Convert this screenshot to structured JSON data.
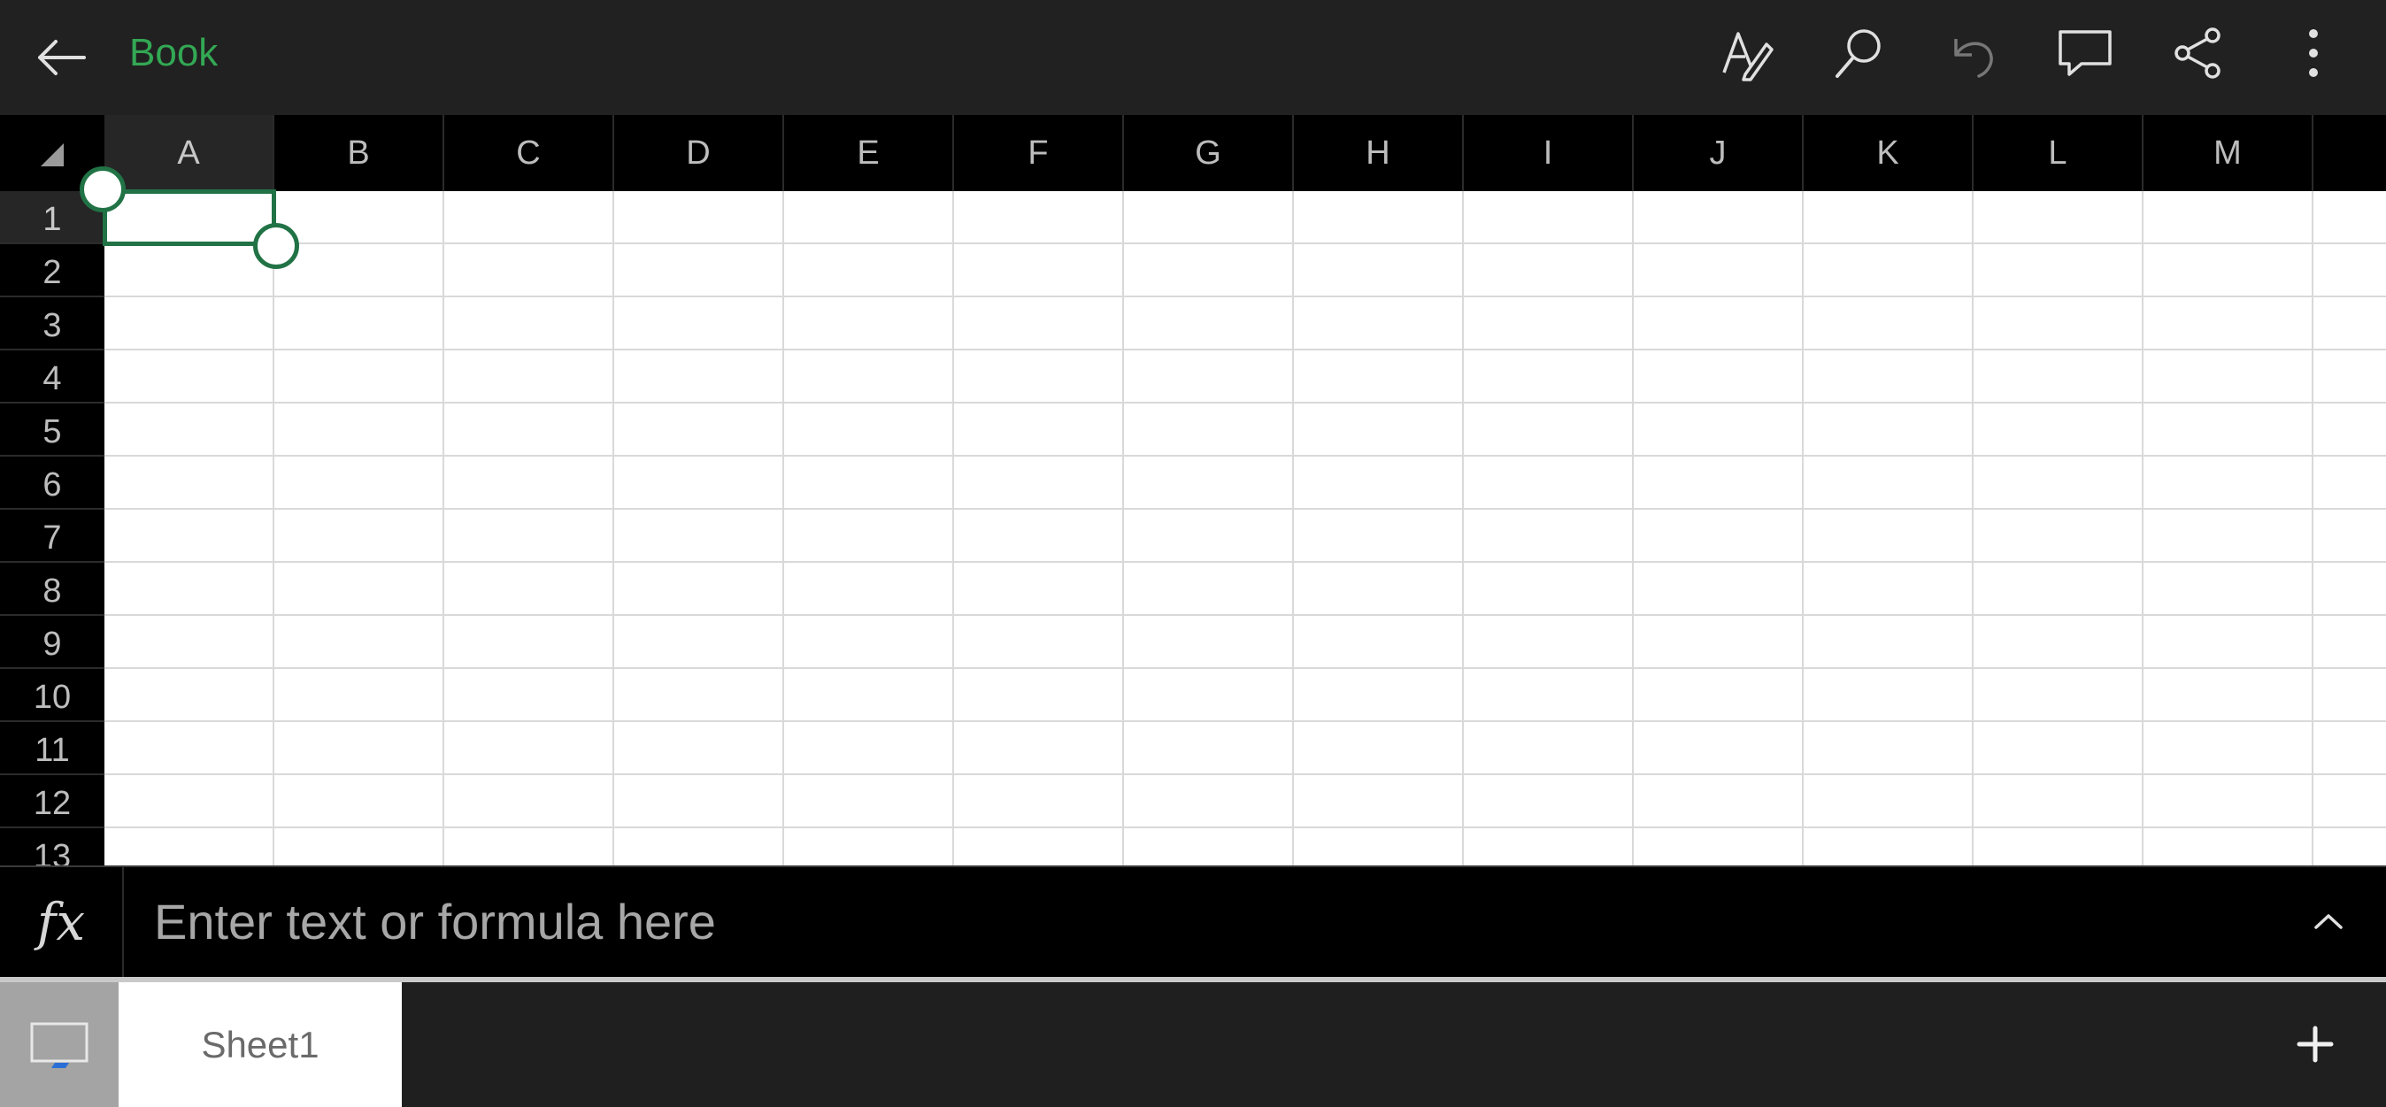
{
  "app": {
    "title": "Book",
    "accent_color": "#33a854",
    "selection_color": "#217346"
  },
  "toolbar": {
    "back_icon": "back-arrow-icon",
    "actions": [
      {
        "name": "draw-button",
        "icon": "pen-draw-icon"
      },
      {
        "name": "search-button",
        "icon": "search-icon"
      },
      {
        "name": "undo-button",
        "icon": "undo-icon",
        "disabled": true
      },
      {
        "name": "comment-button",
        "icon": "comment-icon"
      },
      {
        "name": "share-button",
        "icon": "share-icon"
      },
      {
        "name": "more-button",
        "icon": "more-vertical-icon"
      }
    ]
  },
  "grid": {
    "columns": [
      "A",
      "B",
      "C",
      "D",
      "E",
      "F",
      "G",
      "H",
      "I",
      "J",
      "K",
      "L",
      "M"
    ],
    "rows": [
      "1",
      "2",
      "3",
      "4",
      "5",
      "6",
      "7",
      "8",
      "9",
      "10",
      "11",
      "12",
      "13"
    ],
    "selected_cell": "A1"
  },
  "formula_bar": {
    "fx_label": "fx",
    "placeholder": "Enter text or formula here",
    "value": "",
    "expand_icon": "chevron-up-icon"
  },
  "sheets": {
    "view_icon": "sheets-view-icon",
    "tabs": [
      {
        "label": "Sheet1",
        "active": true
      }
    ],
    "add_label": "+"
  }
}
